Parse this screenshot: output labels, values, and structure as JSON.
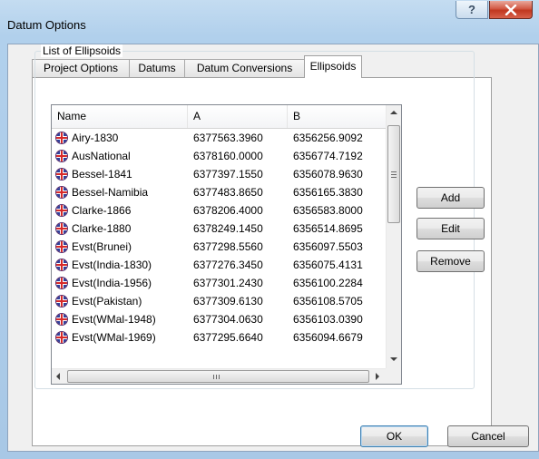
{
  "window": {
    "title": "Datum Options"
  },
  "tabs": [
    {
      "label": "Project Options",
      "active": false
    },
    {
      "label": "Datums",
      "active": false
    },
    {
      "label": "Datum Conversions",
      "active": false
    },
    {
      "label": "Ellipsoids",
      "active": true
    }
  ],
  "ellipsoids": {
    "group_label": "List of Ellipsoids",
    "columns": [
      "Name",
      "A",
      "B"
    ],
    "rows": [
      {
        "name": "Airy-1830",
        "a": "6377563.3960",
        "b": "6356256.9092"
      },
      {
        "name": "AusNational",
        "a": "6378160.0000",
        "b": "6356774.7192"
      },
      {
        "name": "Bessel-1841",
        "a": "6377397.1550",
        "b": "6356078.9630"
      },
      {
        "name": "Bessel-Namibia",
        "a": "6377483.8650",
        "b": "6356165.3830"
      },
      {
        "name": "Clarke-1866",
        "a": "6378206.4000",
        "b": "6356583.8000"
      },
      {
        "name": "Clarke-1880",
        "a": "6378249.1450",
        "b": "6356514.8695"
      },
      {
        "name": "Evst(Brunei)",
        "a": "6377298.5560",
        "b": "6356097.5503"
      },
      {
        "name": "Evst(India-1830)",
        "a": "6377276.3450",
        "b": "6356075.4131"
      },
      {
        "name": "Evst(India-1956)",
        "a": "6377301.2430",
        "b": "6356100.2284"
      },
      {
        "name": "Evst(Pakistan)",
        "a": "6377309.6130",
        "b": "6356108.5705"
      },
      {
        "name": "Evst(WMal-1948)",
        "a": "6377304.0630",
        "b": "6356103.0390"
      },
      {
        "name": "Evst(WMal-1969)",
        "a": "6377295.6640",
        "b": "6356094.6679"
      }
    ],
    "row_icon": "flag-globe-icon",
    "buttons": {
      "add": "Add",
      "edit": "Edit",
      "remove": "Remove"
    }
  },
  "dialog_buttons": {
    "ok": "OK",
    "cancel": "Cancel"
  },
  "title_buttons": {
    "help": "?",
    "close": "X"
  },
  "colors": {
    "close": "#c7402a",
    "accent": "#3c7fb1"
  }
}
